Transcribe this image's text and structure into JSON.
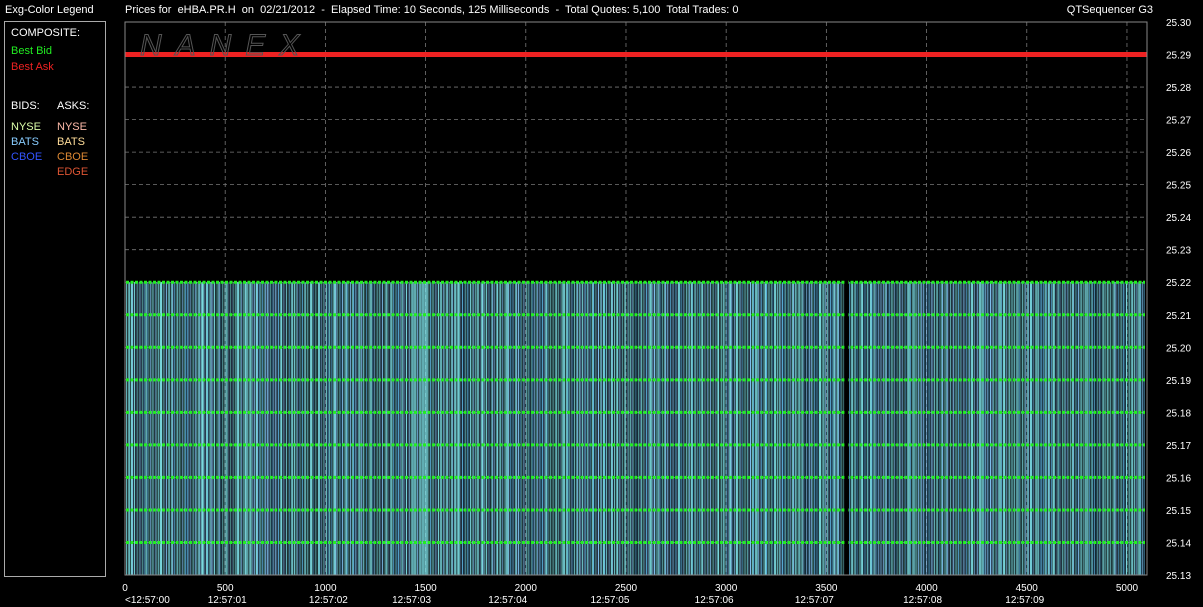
{
  "header": {
    "legend_title": "Exg-Color Legend",
    "chart_title": "Prices for  eHBA.PR.H  on  02/21/2012  -  Elapsed Time: 10 Seconds, 125 Milliseconds  -  Total Quotes: 5,100  Total Trades: 0",
    "app_name": "QTSequencer G3"
  },
  "legend": {
    "composite_label": "COMPOSITE:",
    "best_bid": "Best Bid",
    "best_ask": "Best Ask",
    "bids_label": "BIDS:",
    "asks_label": "ASKS:",
    "bids": [
      "NYSE",
      "BATS",
      "CBOE"
    ],
    "asks": [
      "NYSE",
      "BATS",
      "CBOE",
      "EDGE"
    ],
    "colors": {
      "best_bid": "#22ee22",
      "best_ask": "#ee2222",
      "bid_nyse": "#ddffaa",
      "bid_bats": "#88ccff",
      "bid_cboe": "#3355ff",
      "ask_nyse": "#ffbbaa",
      "ask_bats": "#ffdd99",
      "ask_cboe": "#dd8833",
      "ask_edge": "#dd5533"
    }
  },
  "watermark": "NANEX",
  "chart_data": {
    "type": "line",
    "title": "Prices for  eHBA.PR.H  on  02/21/2012",
    "xlim": [
      0,
      5100
    ],
    "ylim": [
      25.13,
      25.3
    ],
    "x_ticks": [
      0,
      500,
      1000,
      1500,
      2000,
      2500,
      3000,
      3500,
      4000,
      4500,
      5000
    ],
    "time_labels": [
      "<12:57:00",
      "12:57:01",
      "12:57:02",
      "12:57:03",
      "12:57:04",
      "12:57:05",
      "12:57:06",
      "12:57:07",
      "12:57:08",
      "12:57:09"
    ],
    "time_label_x": [
      0,
      510,
      1015,
      1430,
      1910,
      2420,
      2940,
      3440,
      3980,
      4490
    ],
    "y_ticks": [
      "25.30",
      "25.29",
      "25.28",
      "25.27",
      "25.26",
      "25.25",
      "25.24",
      "25.23",
      "25.22",
      "25.21",
      "25.20",
      "25.19",
      "25.18",
      "25.17",
      "25.16",
      "25.15",
      "25.14",
      "25.13"
    ],
    "grid": true,
    "series": [
      {
        "name": "Best Ask",
        "x": [
          0,
          5100
        ],
        "values": [
          25.29,
          25.29
        ]
      },
      {
        "name": "Best Bid",
        "bid_levels": [
          25.22,
          25.21,
          25.2,
          25.19,
          25.18,
          25.17,
          25.16,
          25.15,
          25.14
        ],
        "range": [
          25.14,
          25.22
        ]
      }
    ],
    "gap_x": [
      3590,
      3610
    ]
  }
}
